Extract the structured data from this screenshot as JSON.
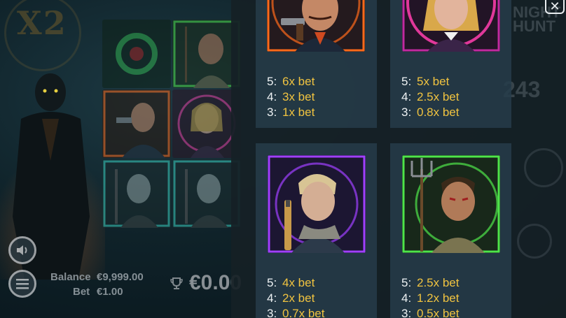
{
  "game": {
    "multiplier": "X2",
    "balance_label": "Balance",
    "balance_value": "€9,999.00",
    "bet_label": "Bet",
    "bet_value": "€1.00",
    "win_value": "€0.00"
  },
  "paytable": {
    "close_symbol": "✕",
    "symbols": [
      {
        "name": "gunslinger",
        "color": "#ff6a1a",
        "payouts": [
          {
            "count": "5:",
            "value": "6x bet"
          },
          {
            "count": "4:",
            "value": "3x bet"
          },
          {
            "count": "3:",
            "value": "1x bet"
          }
        ]
      },
      {
        "name": "lady",
        "color": "#e0389a",
        "payouts": [
          {
            "count": "5:",
            "value": "5x bet"
          },
          {
            "count": "4:",
            "value": "2.5x bet"
          },
          {
            "count": "3:",
            "value": "0.8x bet"
          }
        ]
      },
      {
        "name": "young-hunter",
        "color": "#a040ff",
        "payouts": [
          {
            "count": "5:",
            "value": "4x bet"
          },
          {
            "count": "4:",
            "value": "2x bet"
          },
          {
            "count": "3:",
            "value": "0.7x bet"
          }
        ]
      },
      {
        "name": "pitchfork-farmer",
        "color": "#4ee44a",
        "payouts": [
          {
            "count": "5:",
            "value": "2.5x bet"
          },
          {
            "count": "4:",
            "value": "1.2x bet"
          },
          {
            "count": "3:",
            "value": "0.5x bet"
          }
        ]
      }
    ]
  },
  "icons": {
    "sound": "speaker-icon",
    "menu": "hamburger-icon",
    "trophy": "trophy-icon",
    "close": "close-icon"
  }
}
